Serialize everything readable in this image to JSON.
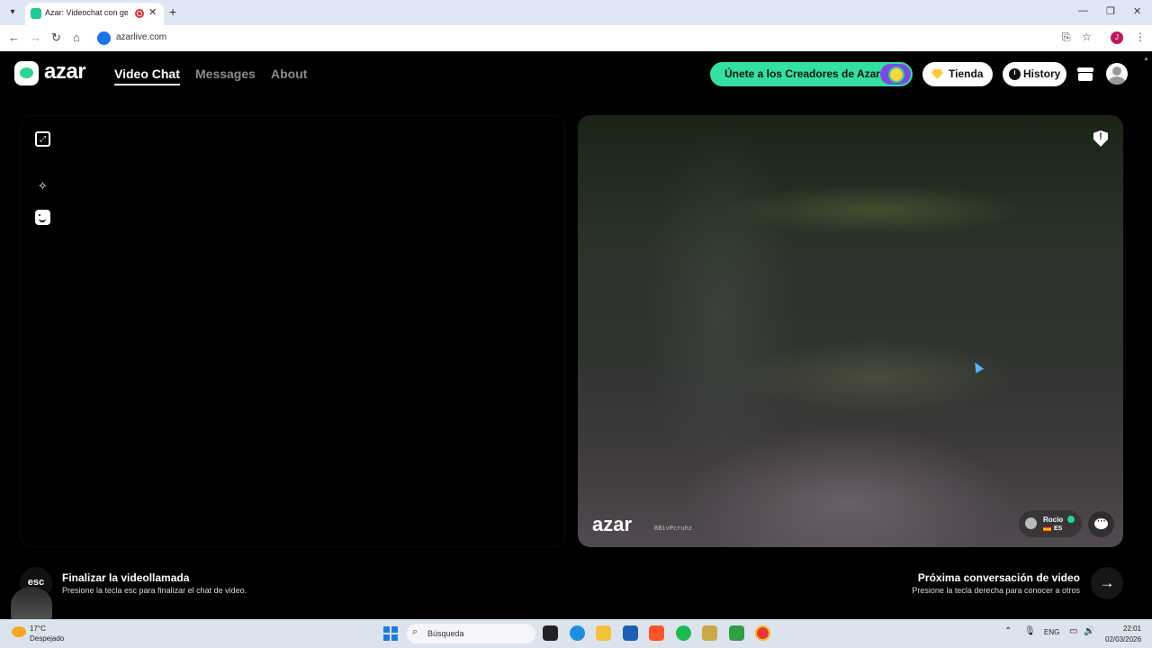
{
  "browser": {
    "tab_title": "Azar: Videochat con gente",
    "url": "azarlive.com",
    "profile_initial": "J"
  },
  "header": {
    "brand": "azar",
    "nav": [
      {
        "label": "Video Chat",
        "active": true
      },
      {
        "label": "Messages",
        "active": false
      },
      {
        "label": "About",
        "active": false
      }
    ],
    "creators_label": "Únete a los Creadores de Azar",
    "shop_label": "Tienda",
    "history_label": "History"
  },
  "local_video": {
    "controls": [
      "expand-icon",
      "magic-wand-icon",
      "face-filter-icon"
    ]
  },
  "remote_video": {
    "watermark": "azar",
    "watermark_code": "RBivPcruhz",
    "report_glyph": "!",
    "user": {
      "name": "Rocio",
      "lang": "ES",
      "verified": true
    }
  },
  "hints": {
    "esc_key": "esc",
    "end_title": "Finalizar la videollamada",
    "end_sub": "Presione la tecla esc para finalizar el chat de video.",
    "next_title": "Próxima conversación de video",
    "next_sub": "Presione la tecla derecha para conocer a otros"
  },
  "taskbar": {
    "weather_temp": "17°C",
    "weather_desc": "Despejado",
    "search_placeholder": "Búsqueda",
    "lang": "ENG",
    "time": "22:01",
    "date": "02/03/2026"
  },
  "colors": {
    "accent": "#34e0a1",
    "background": "#000000",
    "muted_nav": "#8b8b8b"
  }
}
